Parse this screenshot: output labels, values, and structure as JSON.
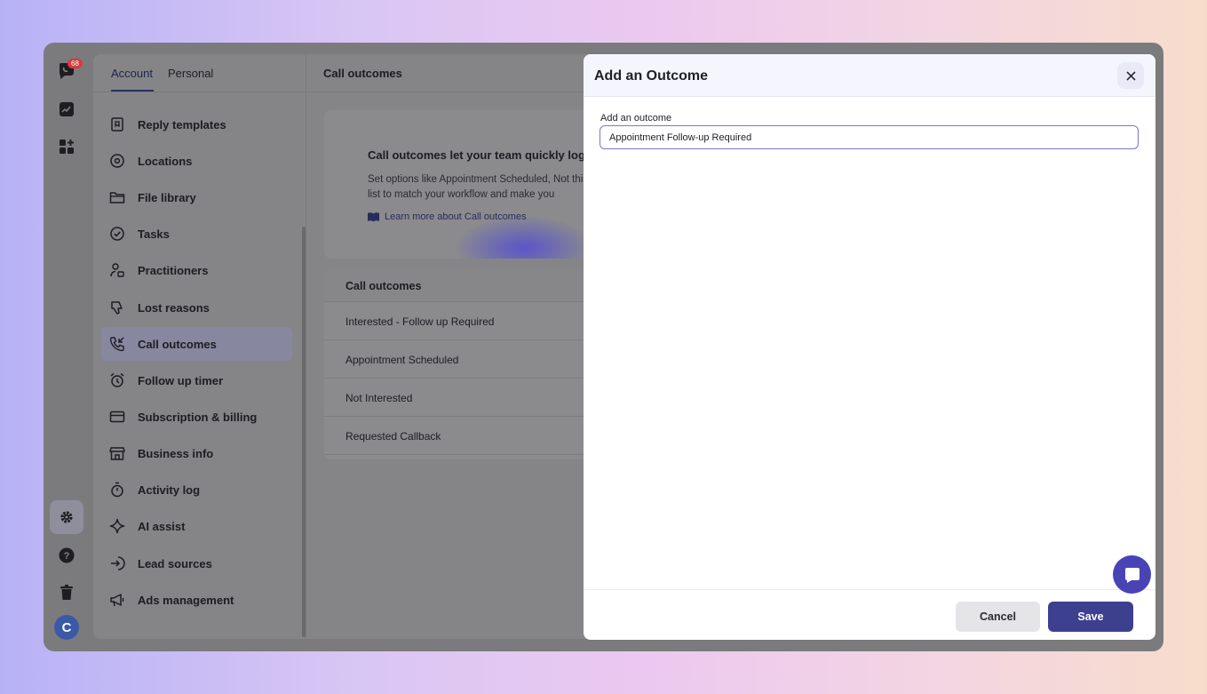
{
  "rail": {
    "notification_count": "68",
    "avatar_initial": "C"
  },
  "sidebar": {
    "tabs": [
      {
        "label": "Account",
        "active": true
      },
      {
        "label": "Personal",
        "active": false
      }
    ],
    "items": [
      {
        "label": "Reply templates",
        "icon": "bookmark-icon"
      },
      {
        "label": "Locations",
        "icon": "location-pin-icon"
      },
      {
        "label": "File library",
        "icon": "folder-icon"
      },
      {
        "label": "Tasks",
        "icon": "check-circle-icon"
      },
      {
        "label": "Practitioners",
        "icon": "user-badge-icon"
      },
      {
        "label": "Lost reasons",
        "icon": "thumbs-down-icon"
      },
      {
        "label": "Call outcomes",
        "icon": "phone-incoming-icon",
        "active": true
      },
      {
        "label": "Follow up timer",
        "icon": "alarm-clock-icon"
      },
      {
        "label": "Subscription & billing",
        "icon": "credit-card-icon"
      },
      {
        "label": "Business info",
        "icon": "store-icon"
      },
      {
        "label": "Activity log",
        "icon": "stopwatch-icon"
      },
      {
        "label": "AI assist",
        "icon": "sparkle-icon"
      },
      {
        "label": "Lead sources",
        "icon": "sign-in-icon"
      },
      {
        "label": "Ads management",
        "icon": "megaphone-icon"
      }
    ]
  },
  "content": {
    "title": "Call outcomes",
    "info": {
      "title": "Call outcomes let your team quickly log w",
      "body": "Set options like Appointment Scheduled, Not this list to match your workflow and make you",
      "link": "Learn more about Call outcomes"
    },
    "table": {
      "header": "Call outcomes",
      "rows": [
        "Interested - Follow up Required",
        "Appointment Scheduled",
        "Not Interested",
        "Requested Callback"
      ]
    }
  },
  "modal": {
    "title": "Add an Outcome",
    "field_label": "Add an outcome",
    "field_value": "Appointment Follow-up Required",
    "cancel_label": "Cancel",
    "save_label": "Save"
  },
  "colors": {
    "primary": "#3d3f8f",
    "chat_button": "#4a43b5",
    "badge": "#d43b3b"
  }
}
